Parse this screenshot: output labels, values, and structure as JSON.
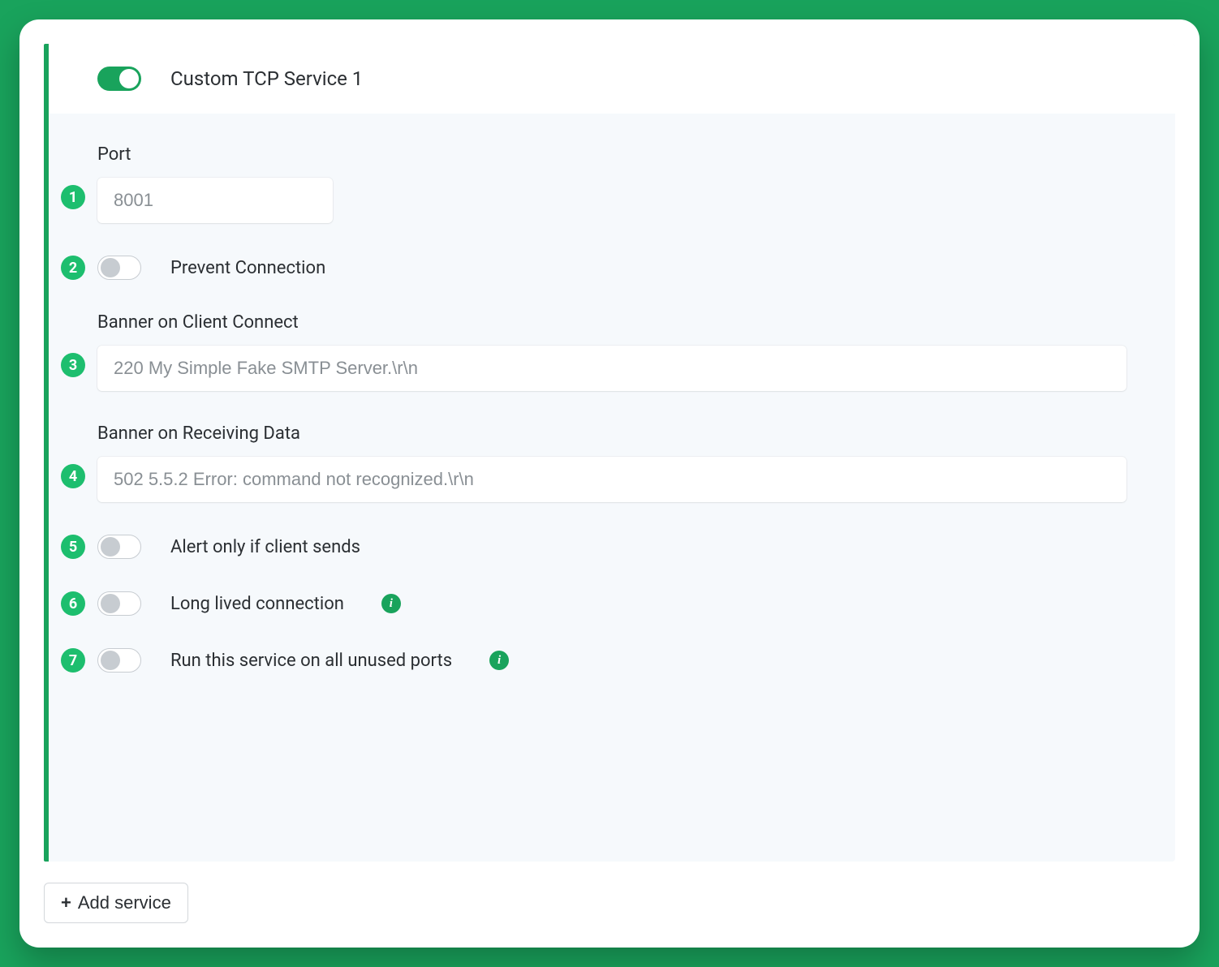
{
  "header": {
    "title": "Custom TCP Service 1",
    "enabled": true
  },
  "fields": {
    "port": {
      "label": "Port",
      "placeholder": "8001",
      "badge": "1"
    },
    "prevent_connection": {
      "label": "Prevent Connection",
      "badge": "2",
      "enabled": false
    },
    "banner_connect": {
      "label": "Banner on Client Connect",
      "placeholder": "220 My Simple Fake SMTP Server.\\r\\n",
      "badge": "3"
    },
    "banner_receive": {
      "label": "Banner on Receiving Data",
      "placeholder": "502 5.5.2 Error: command not recognized.\\r\\n",
      "badge": "4"
    },
    "alert_only": {
      "label": "Alert only if client sends",
      "badge": "5",
      "enabled": false
    },
    "long_lived": {
      "label": "Long lived connection",
      "badge": "6",
      "enabled": false
    },
    "all_ports": {
      "label": "Run this service on all unused ports",
      "badge": "7",
      "enabled": false
    }
  },
  "footer": {
    "add_service_label": "Add service"
  }
}
